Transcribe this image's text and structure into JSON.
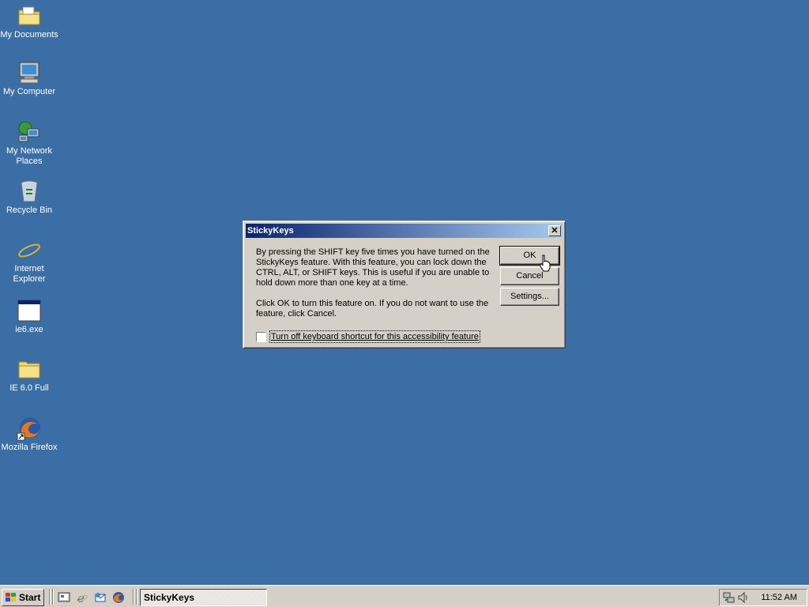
{
  "desktop": {
    "icons": [
      {
        "label": "My Documents",
        "icon": "folder-documents-icon"
      },
      {
        "label": "My Computer",
        "icon": "computer-icon"
      },
      {
        "label": "My Network Places",
        "icon": "network-places-icon"
      },
      {
        "label": "Recycle Bin",
        "icon": "recycle-bin-icon"
      },
      {
        "label": "Internet Explorer",
        "icon": "internet-explorer-icon"
      },
      {
        "label": "ie6.exe",
        "icon": "application-window-icon"
      },
      {
        "label": "IE 6.0 Full",
        "icon": "folder-icon"
      },
      {
        "label": "Mozilla Firefox",
        "icon": "firefox-icon"
      }
    ],
    "background_color": "#3a6ea5"
  },
  "dialog": {
    "title": "StickyKeys",
    "close_glyph": "✕",
    "message1": "By pressing the SHIFT key five times you have turned on the StickyKeys feature. With this feature, you can lock down the CTRL, ALT, or SHIFT keys. This is useful if you are unable to hold down more than one key at a time.",
    "message2": "Click OK to turn this feature on.  If you do not want to use the feature, click Cancel.",
    "ok_label": "OK",
    "cancel_label": "Cancel",
    "settings_label": "Settings...",
    "checkbox_label": "Turn off keyboard shortcut for this accessibility feature",
    "checkbox_checked": false
  },
  "taskbar": {
    "start_label": "Start",
    "quick_launch": [
      "show-desktop-icon",
      "internet-explorer-icon",
      "outlook-express-icon",
      "firefox-icon"
    ],
    "task_label": "StickyKeys",
    "clock": "11:52 AM"
  }
}
